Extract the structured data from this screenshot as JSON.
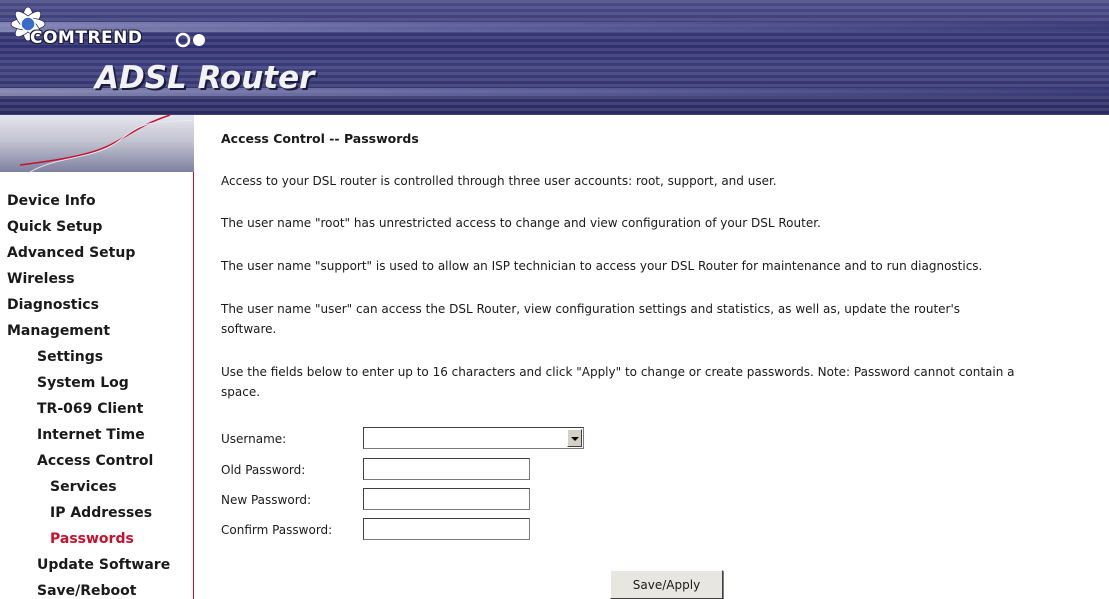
{
  "header": {
    "brand": "COMTREND",
    "product": "ADSL Router"
  },
  "sidebar": {
    "items": [
      {
        "label": "Device Info"
      },
      {
        "label": "Quick Setup"
      },
      {
        "label": "Advanced Setup"
      },
      {
        "label": "Wireless"
      },
      {
        "label": "Diagnostics"
      },
      {
        "label": "Management"
      },
      {
        "label": "Settings"
      },
      {
        "label": "System Log"
      },
      {
        "label": "TR-069 Client"
      },
      {
        "label": "Internet Time"
      },
      {
        "label": "Access Control"
      },
      {
        "label": "Services"
      },
      {
        "label": "IP Addresses"
      },
      {
        "label": "Passwords"
      },
      {
        "label": "Update Software"
      },
      {
        "label": "Save/Reboot"
      }
    ],
    "active_color": "#c8102e"
  },
  "main": {
    "title": "Access Control -- Passwords",
    "paragraphs": [
      "Access to your DSL router is controlled through three user accounts: root, support, and user.",
      "The user name \"root\" has unrestricted access to change and view configuration of your DSL Router.",
      "The user name \"support\" is used to allow an ISP technician to access your DSL Router for maintenance and to run diagnostics.",
      "The user name \"user\" can access the DSL Router, view configuration settings and statistics, as well as, update the router's",
      "software.",
      "Use the fields below to enter up to 16 characters and click \"Apply\" to change or create passwords. Note: Password cannot contain a",
      "space."
    ],
    "form": {
      "username_label": "Username:",
      "username_value": "",
      "old_password_label": "Old Password:",
      "old_password_value": "",
      "new_password_label": "New Password:",
      "new_password_value": "",
      "confirm_password_label": "Confirm Password:",
      "confirm_password_value": "",
      "submit_label": "Save/Apply"
    }
  }
}
